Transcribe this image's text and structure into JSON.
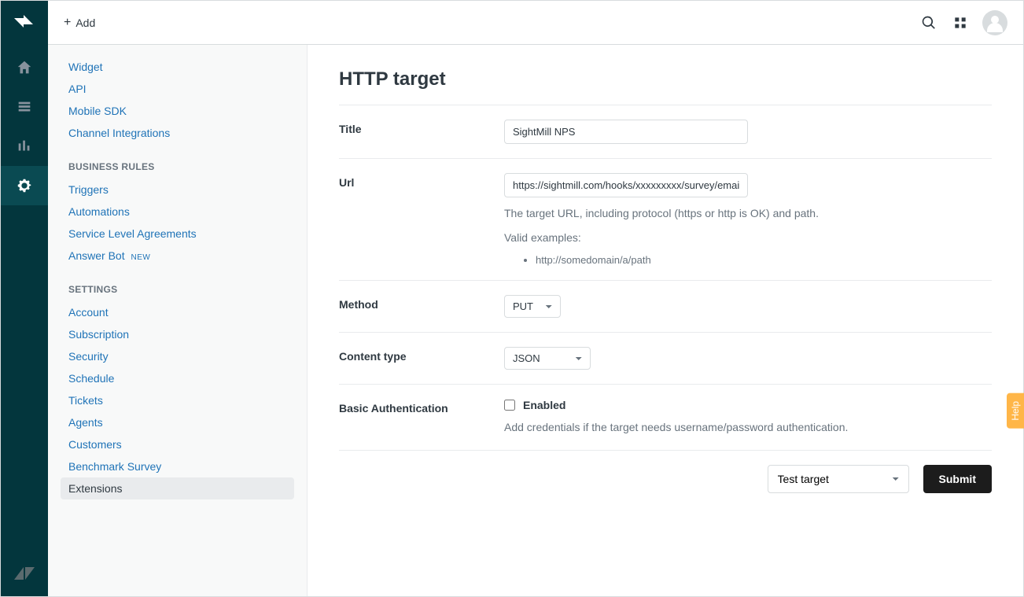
{
  "topbar": {
    "add_label": "Add"
  },
  "sidebar": {
    "channels": {
      "items": [
        {
          "label": "Widget"
        },
        {
          "label": "API"
        },
        {
          "label": "Mobile SDK"
        },
        {
          "label": "Channel Integrations"
        }
      ]
    },
    "business_rules": {
      "header": "BUSINESS RULES",
      "items": [
        {
          "label": "Triggers"
        },
        {
          "label": "Automations"
        },
        {
          "label": "Service Level Agreements"
        },
        {
          "label": "Answer Bot",
          "tag": "NEW"
        }
      ]
    },
    "settings": {
      "header": "SETTINGS",
      "items": [
        {
          "label": "Account"
        },
        {
          "label": "Subscription"
        },
        {
          "label": "Security"
        },
        {
          "label": "Schedule"
        },
        {
          "label": "Tickets"
        },
        {
          "label": "Agents"
        },
        {
          "label": "Customers"
        },
        {
          "label": "Benchmark Survey"
        },
        {
          "label": "Extensions",
          "active": true
        }
      ]
    }
  },
  "page": {
    "title": "HTTP target",
    "form": {
      "title": {
        "label": "Title",
        "value": "SightMill NPS"
      },
      "url": {
        "label": "Url",
        "value": "https://sightmill.com/hooks/xxxxxxxxx/survey/email",
        "help1": "The target URL, including protocol (https or http is OK) and path.",
        "help2": "Valid examples:",
        "example": "http://somedomain/a/path"
      },
      "method": {
        "label": "Method",
        "value": "PUT"
      },
      "content_type": {
        "label": "Content type",
        "value": "JSON"
      },
      "basic_auth": {
        "label": "Basic Authentication",
        "checkbox_label": "Enabled",
        "checked": false,
        "help": "Add credentials if the target needs username/password authentication."
      }
    },
    "actions": {
      "test_target": "Test target",
      "submit": "Submit"
    }
  },
  "help_tab": "Help"
}
